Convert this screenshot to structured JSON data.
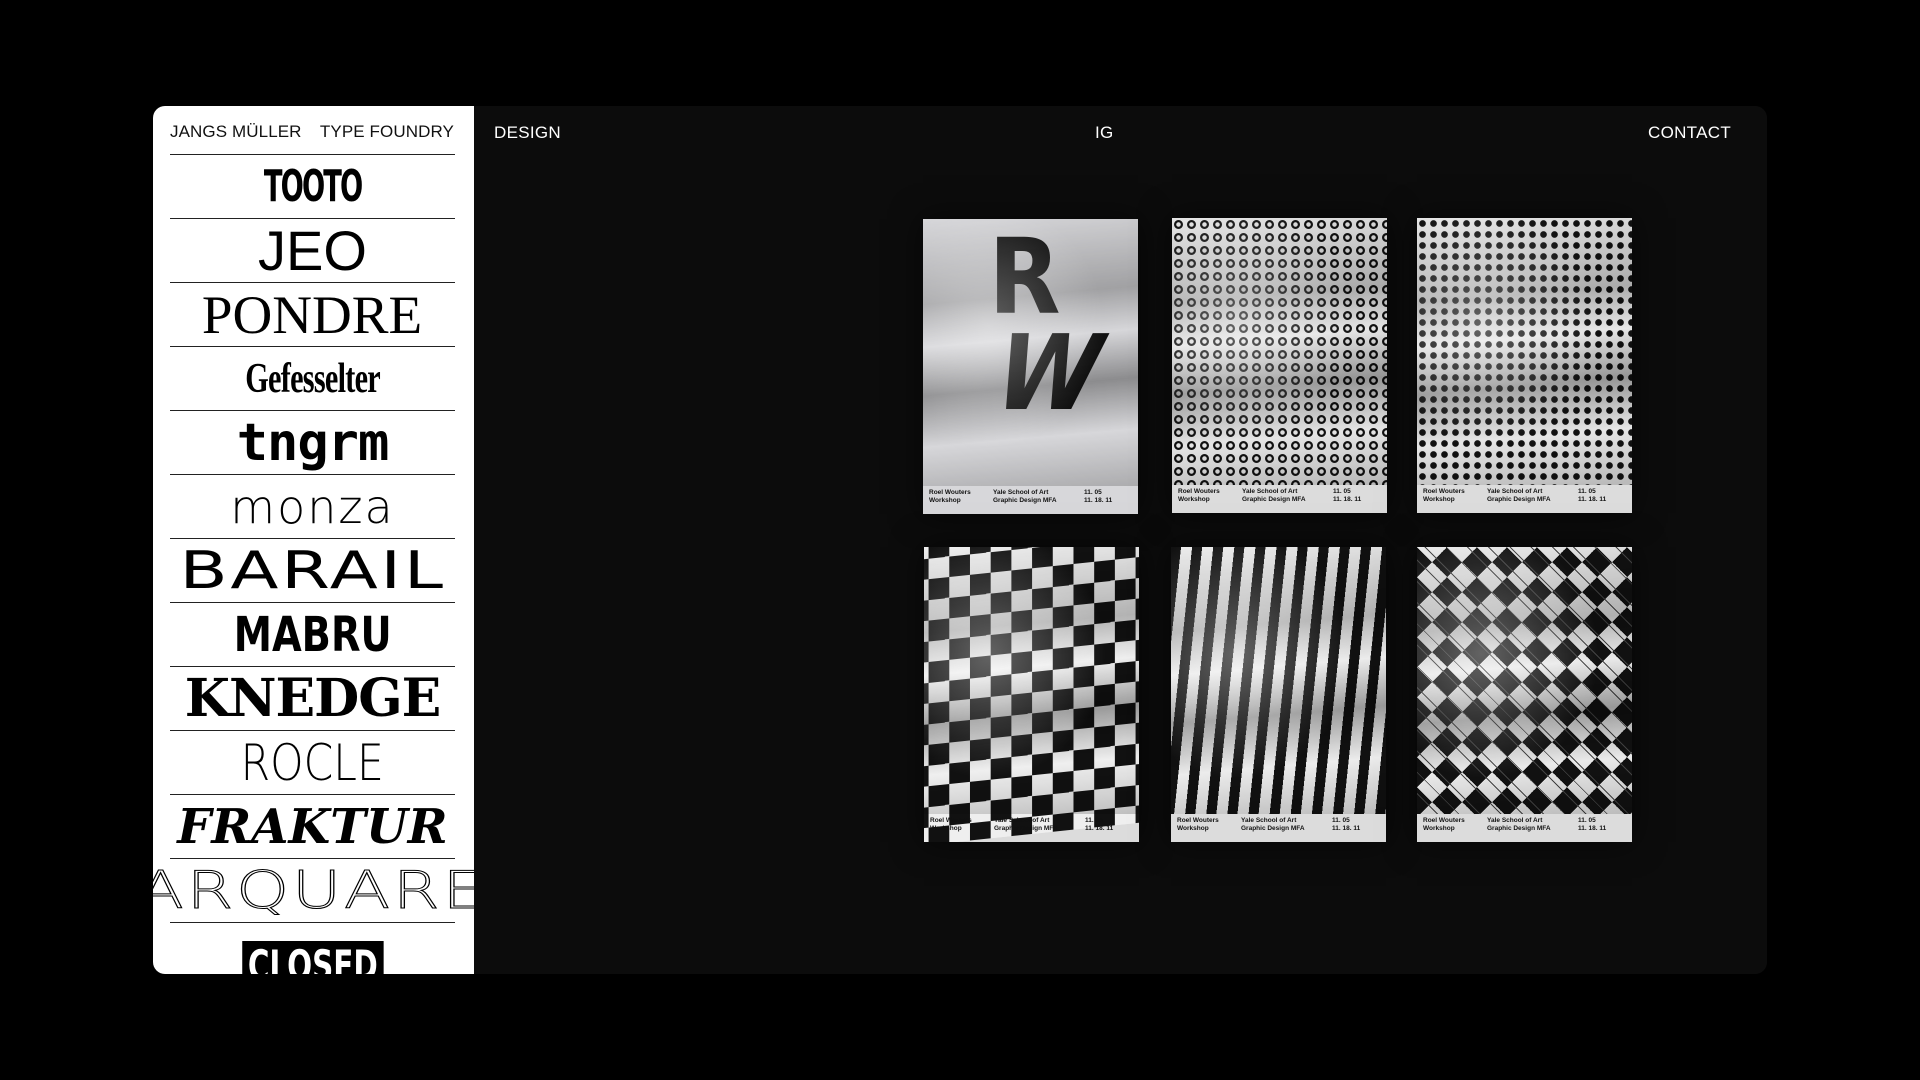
{
  "sidebar": {
    "brand": "JANGS MÜLLER",
    "section": "TYPE FOUNDRY",
    "fonts": [
      "TOOTO",
      "JEO",
      "PONDRE",
      "Gefesselter",
      "tngrm",
      "monza",
      "BARAIL",
      "MABRU",
      "KNEDGE",
      "ROCLE",
      "FRAKTUR",
      "ARQUARE",
      "CLOSED"
    ]
  },
  "nav": {
    "design": "DESIGN",
    "ig": "IG",
    "contact": "CONTACT"
  },
  "posters": [
    {
      "pattern": "letters-RW",
      "letters": [
        "R",
        "W"
      ],
      "col1": [
        "Roel Wouters",
        "Workshop"
      ],
      "col2": [
        "Yale School of Art",
        "Graphic Design MFA"
      ],
      "col3": [
        "11. 05",
        "11. 18. 11"
      ]
    },
    {
      "pattern": "rings",
      "col1": [
        "Roel Wouters",
        "Workshop"
      ],
      "col2": [
        "Yale School of Art",
        "Graphic Design MFA"
      ],
      "col3": [
        "11. 05",
        "11. 18. 11"
      ]
    },
    {
      "pattern": "dots",
      "col1": [
        "Roel Wouters",
        "Workshop"
      ],
      "col2": [
        "Yale School of Art",
        "Graphic Design MFA"
      ],
      "col3": [
        "11. 05",
        "11. 18. 11"
      ]
    },
    {
      "pattern": "checkerboard",
      "col1": [
        "Roel Wouters",
        "Workshop"
      ],
      "col2": [
        "Yale School of Art",
        "Graphic Design MFA"
      ],
      "col3": [
        "11. 05",
        "11. 18. 11"
      ]
    },
    {
      "pattern": "stripes",
      "col1": [
        "Roel Wouters",
        "Workshop"
      ],
      "col2": [
        "Yale School of Art",
        "Graphic Design MFA"
      ],
      "col3": [
        "11. 05",
        "11. 18. 11"
      ]
    },
    {
      "pattern": "argyle",
      "col1": [
        "Roel Wouters",
        "Workshop"
      ],
      "col2": [
        "Yale School of Art",
        "Graphic Design MFA"
      ],
      "col3": [
        "11. 05",
        "11. 18. 11"
      ]
    }
  ],
  "colors": {
    "page_background": "#000000",
    "sidebar_background": "#ffffff",
    "main_background": "#0c0c0c",
    "nav_text": "#ffffff",
    "sidebar_text": "#111111"
  }
}
